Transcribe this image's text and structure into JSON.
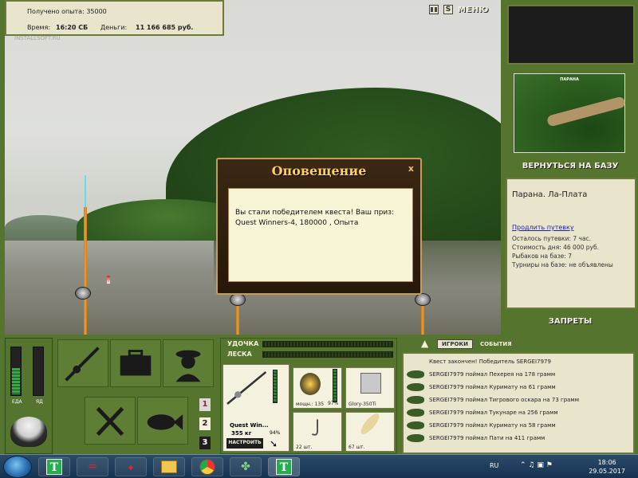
{
  "top": {
    "exp_label": "Получено опыта: 35000",
    "time_label": "Время:",
    "time_value": "16:20 СБ",
    "money_label": "Деньги:",
    "money_value": "11 166 685 руб.",
    "menu_label": "МЕНЮ",
    "s_label": "S",
    "watermark": "INSTALLSOFT.RU"
  },
  "right": {
    "map_caption": "ПАРАНА",
    "back_label": "ВЕРНУТЬСЯ НА БАЗУ",
    "location_title": "Парана. Ла-Плата",
    "extend_link": "Продлить путевку",
    "lines": [
      "Осталось путевки: 7 час.",
      "Стоимость дня: 46 000 руб.",
      "Рыбаков на базе: 7",
      "Турниры на базе: не объявлены"
    ],
    "bans_label": "ЗАПРЕТЫ"
  },
  "dialog": {
    "title": "Оповещение",
    "close": "x",
    "message_line1": "Вы стали победителем квеста! Ваш приз:",
    "message_line2": "Quest Winners-4, 180000 , Опыта"
  },
  "hud_left": {
    "food_label": "ЕДА",
    "poison_label": "ЯД",
    "food_level": 0.55,
    "poison_level": 0
  },
  "tools": {
    "buttons": [
      "1",
      "2",
      "3"
    ]
  },
  "gear": {
    "rod_label": "УДОЧКА",
    "line_label": "ЛЕСКА",
    "rod_name": "Quest Win...",
    "rod_weight": "355 кг",
    "rod_pct": "94%",
    "reel_power": "мощн.: 135",
    "reel_pct": "97%",
    "line_name": "Glory-350Ti",
    "hooks_count": "22 шт.",
    "bait_count": "67 шт.",
    "setup_label": "НАСТРОИТЬ"
  },
  "events": {
    "tab_players": "ИГРОКИ",
    "tab_events": "СОБЫТИЯ",
    "rows": [
      "Квест закончен! Победитель SERGEI7979",
      "SERGEI7979 поймал Пехерея на 178 грамм",
      "SERGEI7979 поймал Куримату на 61 грамм",
      "SERGEI7979 поймал Тигрового оскара на 73 грамм",
      "SERGEI7979 поймал Тукунаре на 256 грамм",
      "SERGEI7979 поймал Куримату на 58 грамм",
      "SERGEI7979 поймал Пати на 411 грамм"
    ]
  },
  "taskbar": {
    "t_label": "T",
    "t2_label": "T",
    "lang": "RU",
    "time": "18:06",
    "date": "29.05.2017"
  }
}
